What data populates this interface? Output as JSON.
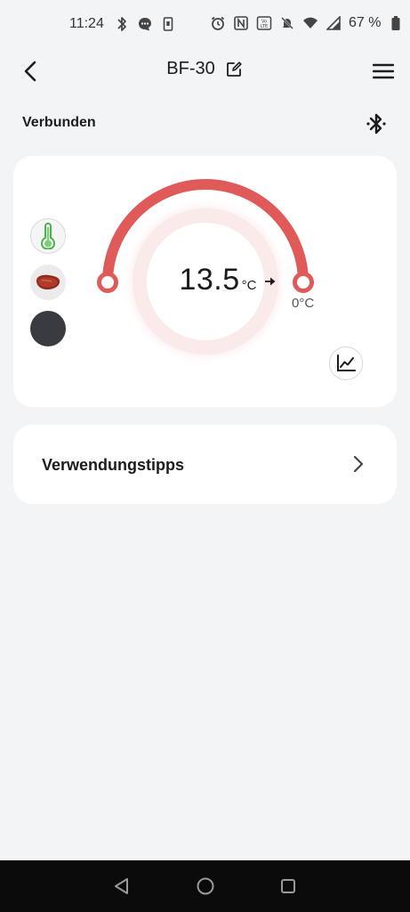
{
  "status_bar": {
    "time": "11:24",
    "battery": "67 %",
    "left_icons": [
      "bluetooth-icon",
      "chat-bubble-icon",
      "sim-icon"
    ],
    "right_icons": [
      "alarm-icon",
      "nfc-icon",
      "volte-icon",
      "mute-icon",
      "wifi-icon",
      "signal-icon"
    ]
  },
  "app_bar": {
    "title": "BF-30",
    "back_icon": "chevron-left-icon",
    "edit_icon": "edit-icon",
    "menu_icon": "hamburger-menu-icon"
  },
  "connection": {
    "label": "Verbunden",
    "icon": "bluetooth-icon"
  },
  "probe_card": {
    "probes": [
      "thermometer-icon",
      "steak-icon",
      "dark-circle-icon"
    ],
    "current_temp": "13.5",
    "current_unit": "°C",
    "target_temp": "0°C",
    "arrow_icon": "arrow-right-icon",
    "chart_icon": "line-chart-icon",
    "accent_color": "#e05a5a"
  },
  "tips": {
    "label": "Verwendungstipps",
    "chevron_icon": "chevron-right-icon"
  },
  "nav_bar": {
    "icons": [
      "back-triangle-icon",
      "home-circle-icon",
      "recents-square-icon"
    ]
  }
}
